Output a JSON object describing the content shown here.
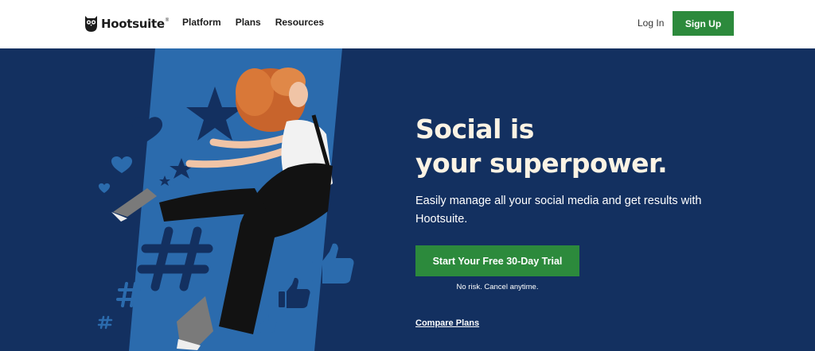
{
  "nav": {
    "logo_text": "Hootsuite",
    "logo_mark": "®",
    "links": [
      "Platform",
      "Plans",
      "Resources"
    ],
    "login_label": "Log In",
    "signup_label": "Sign Up"
  },
  "hero": {
    "headline_line1": "Social is",
    "headline_line2": "your superpower.",
    "subtext": "Easily manage all your social media and get results with Hootsuite.",
    "cta_label": "Start Your Free 30-Day Trial",
    "cta_note": "No risk. Cancel anytime.",
    "compare_label": "Compare Plans"
  },
  "colors": {
    "brand_green": "#2c8a3c",
    "hero_navy": "#133060",
    "hero_blue_stripe": "#2b6bad",
    "headline_cream": "#fcf3e4"
  },
  "icons": [
    "owl-logo-icon",
    "star-icon",
    "heart-icon",
    "hashtag-icon",
    "thumbs-up-icon"
  ]
}
